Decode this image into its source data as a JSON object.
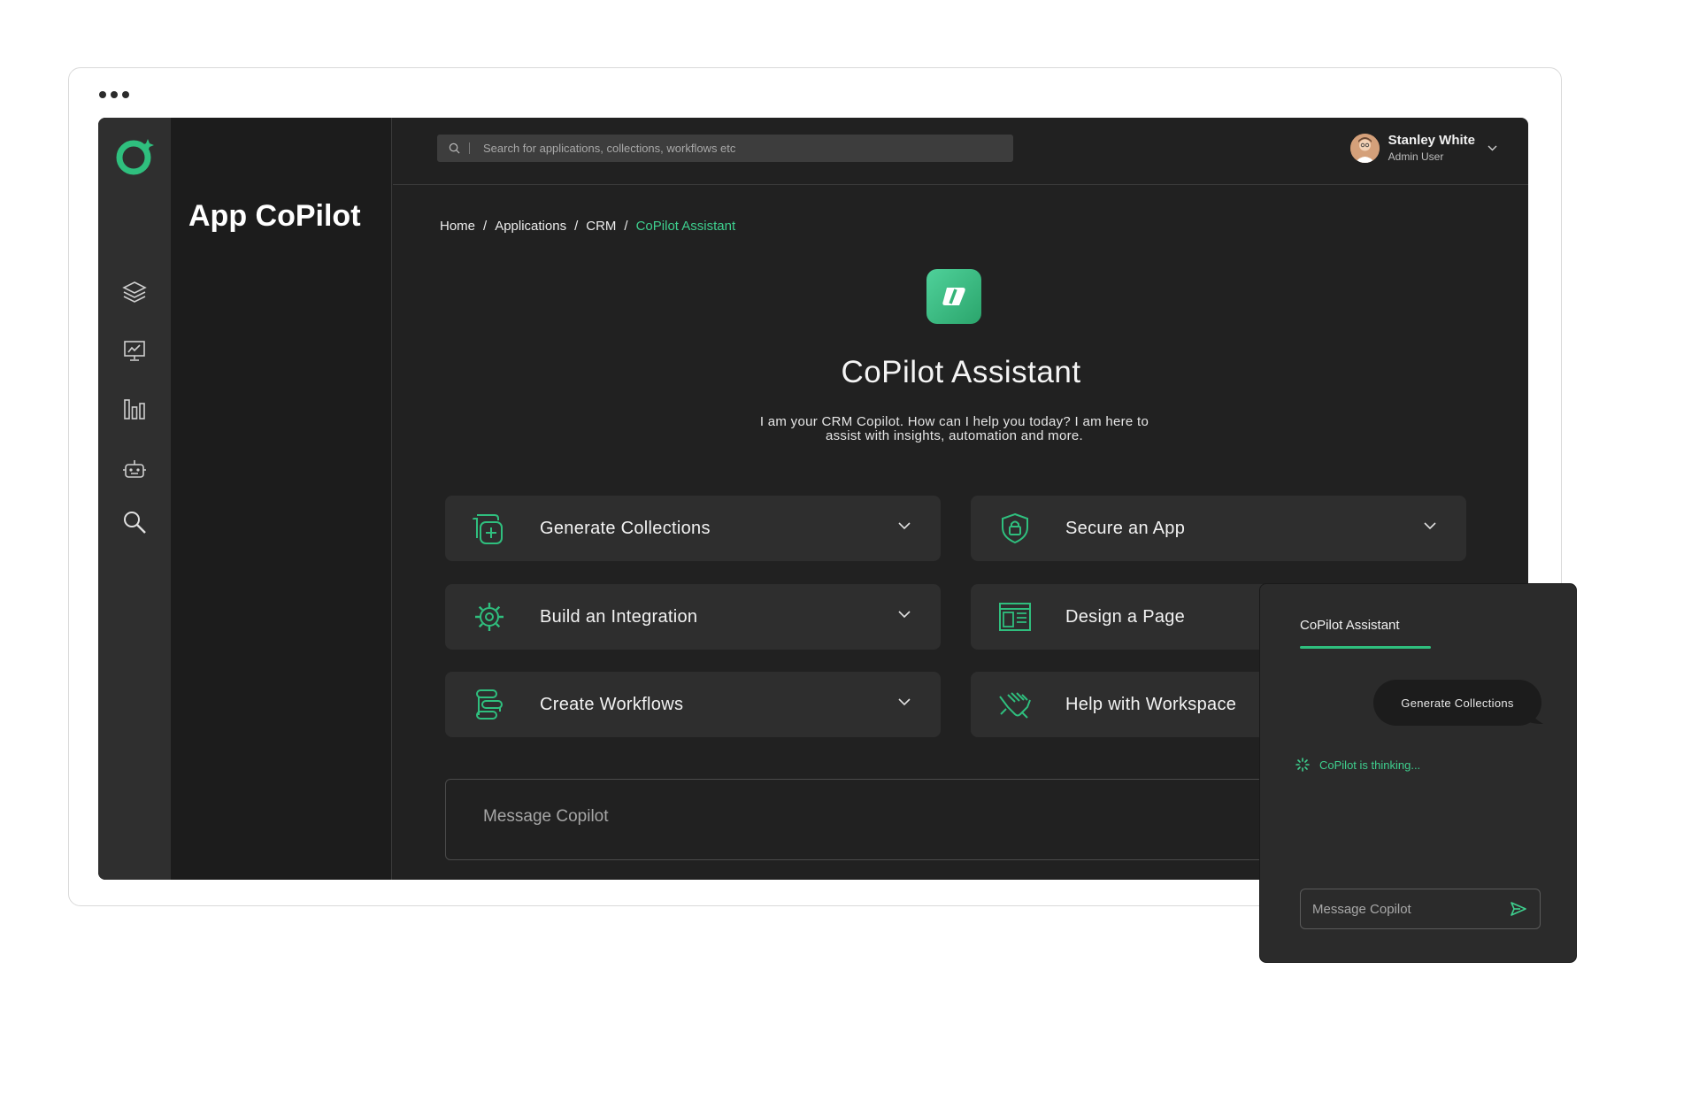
{
  "app": {
    "title": "App CoPilot"
  },
  "search": {
    "placeholder": "Search for applications, collections, workflows etc"
  },
  "user": {
    "name": "Stanley White",
    "role": "Admin User"
  },
  "breadcrumb": [
    "Home",
    "Applications",
    "CRM",
    "CoPilot  Assistant"
  ],
  "hero": {
    "title": "CoPilot Assistant",
    "subtitle_line1": "I am your CRM Copilot. How can I help you today? I am here to",
    "subtitle_line2": "assist with insights, automation and more."
  },
  "cards": [
    {
      "label": "Generate Collections",
      "icon": "collection-add-icon"
    },
    {
      "label": "Secure an App",
      "icon": "shield-lock-icon"
    },
    {
      "label": "Build an Integration",
      "icon": "gear-integration-icon"
    },
    {
      "label": "Design a Page",
      "icon": "page-layout-icon"
    },
    {
      "label": "Create Workflows",
      "icon": "workflow-icon"
    },
    {
      "label": "Help with Workspace",
      "icon": "handshake-icon"
    }
  ],
  "message": {
    "placeholder": "Message Copilot"
  },
  "popup": {
    "tab": "CoPilot Assistant",
    "user_message": "Generate Collections",
    "status": "CoPilot is thinking...",
    "placeholder": "Message Copilot"
  },
  "colors": {
    "accent": "#3ecf8e",
    "app_bg": "#212121",
    "rail_bg": "#2f2f2f",
    "card_bg": "#2e2e2e"
  }
}
